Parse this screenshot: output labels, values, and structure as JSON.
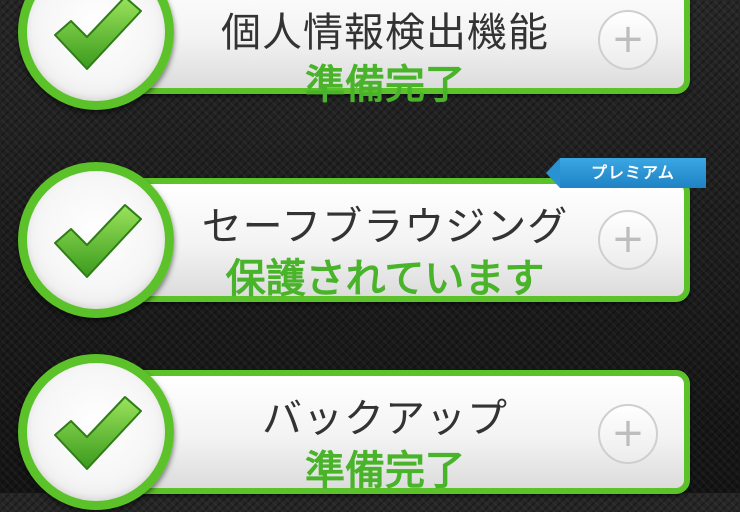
{
  "colors": {
    "accent_green": "#5cc22a",
    "status_green": "#49b329",
    "ribbon_blue": "#2a92d2",
    "background": "#1c1c1c"
  },
  "features": [
    {
      "title": "個人情報検出機能",
      "status": "準備完了",
      "premium": false,
      "check_icon": "check-icon",
      "action_icon": "plus-icon",
      "action_symbol": "+"
    },
    {
      "title": "セーフブラウジング",
      "status": "保護されています",
      "premium": true,
      "premium_label": "プレミアム",
      "check_icon": "check-icon",
      "action_icon": "plus-icon",
      "action_symbol": "+"
    },
    {
      "title": "バックアップ",
      "status": "準備完了",
      "premium": false,
      "check_icon": "check-icon",
      "action_icon": "plus-icon",
      "action_symbol": "+"
    }
  ]
}
